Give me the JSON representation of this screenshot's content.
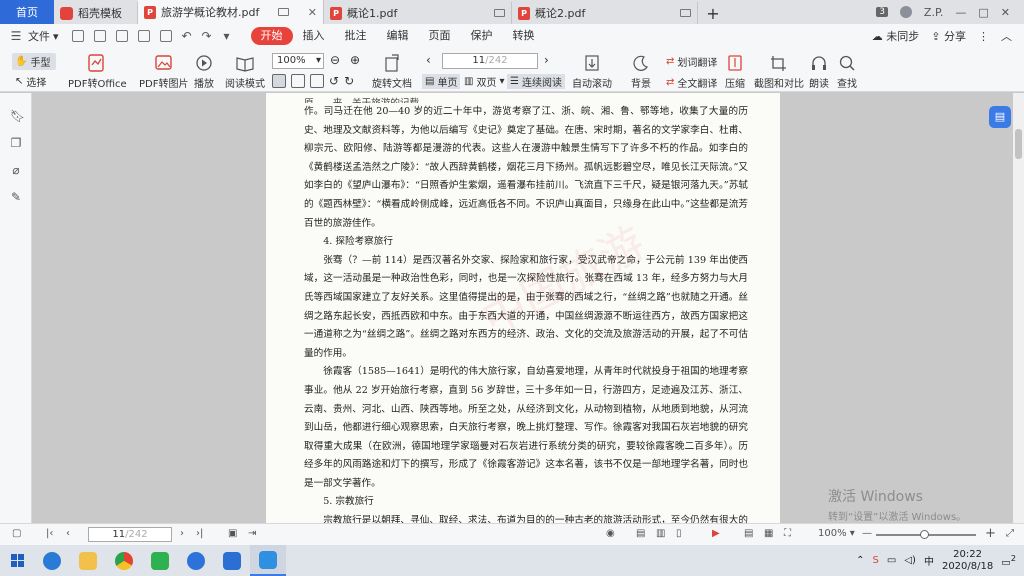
{
  "tabs": {
    "home": "首页",
    "items": [
      {
        "label": "稻壳模板"
      },
      {
        "label": "旅游学概论教材.pdf"
      },
      {
        "label": "概论1.pdf"
      },
      {
        "label": "概论2.pdf"
      }
    ],
    "add": "+"
  },
  "window": {
    "badge": "3",
    "user": "Z.P.",
    "minimize": "—",
    "restore": "□",
    "close": "✕"
  },
  "menu": {
    "file": "文件",
    "tabs": [
      "开始",
      "插入",
      "批注",
      "编辑",
      "页面",
      "保护",
      "转换"
    ],
    "sync": "未同步",
    "share": "分享"
  },
  "ribbon": {
    "hand": "手型",
    "select": "选择",
    "pdf_office": "PDF转Office",
    "pdf_image": "PDF转图片",
    "play": "播放",
    "read_mode": "阅读模式",
    "zoom": "100%",
    "rotate": "旋转文档",
    "page_current": "11",
    "page_total": "/242",
    "single": "单页",
    "double": "双页",
    "continuous": "连续阅读",
    "auto_scroll": "自动滚动",
    "background": "背景",
    "word_translate": "划词翻译",
    "full_translate": "全文翻译",
    "compress": "压缩",
    "screenshot": "截图和对比",
    "read_aloud": "朗读",
    "find": "查找"
  },
  "document": {
    "paragraphs": [
      {
        "type": "body",
        "text": "作。司马迁在他 20—40 岁的近二十年中，游览考察了江、浙、皖、湘、鲁、鄂等地，收集了大量的历史、地理及文献资料等，为他以后编写《史记》奠定了基础。在唐、宋时期，著名的文学家李白、杜甫、柳宗元、欧阳修、陆游等都是漫游的代表。这些人在漫游中触景生情写下了许多不朽的作品。如李白的《黄鹤楼送孟浩然之广陵》：“故人西辞黄鹤楼，烟花三月下扬州。孤帆远影碧空尽，唯见长江天际流。”又如李白的《望庐山瀑布》：“日照香炉生紫烟，遥看瀑布挂前川。飞流直下三千尺，疑是银河落九天。”苏轼的《题西林壁》：“横看成岭侧成峰，远近高低各不同。不识庐山真面目，只缘身在此山中。”这些都是流芳百世的旅游佳作。"
      },
      {
        "type": "heading",
        "text": "4. 探险考察旅行"
      },
      {
        "type": "indent",
        "text": "张骞（？—前 114）是西汉著名外交家、探险家和旅行家，受汉武帝之命，于公元前 139 年出使西域，这一活动虽是一种政治性色彩，同时，也是一次探险性旅行。张骞在西域 13 年，经多方努力与大月氏等西域国家建立了友好关系。这里值得提出的是，由于张骞的西域之行，“丝绸之路”也就随之开通。丝绸之路东起长安，西抵西欧和中东。由于东西大道的开通，中国丝绸源源不断运往西方，故西方国家把这一通道称之为“丝绸之路”。丝绸之路对东西方的经济、政治、文化的交流及旅游活动的开展，起了不可估量的作用。"
      },
      {
        "type": "indent",
        "text": "徐霞客（1585—1641）是明代的伟大旅行家，自幼喜爱地理，从青年时代就投身于祖国的地理考察事业。他从 22 岁开始旅行考察，直到 56 岁辞世，三十多年如一日，行游四方，足迹遍及江苏、浙江、云南、贵州、河北、山西、陕西等地。所至之处，从经济到文化，从动物到植物，从地质到地貌，从河流到山岳，他都进行细心观察思索，白天旅行考察，晚上挑灯整理、写作。徐霞客对我国石灰岩地貌的研究取得重大成果（在欧洲，德国地理学家瑙曼对石灰岩进行系统分类的研究，要较徐霞客晚二百多年）。历经多年的风雨路途和灯下的撰写，形成了《徐霞客游记》这本名著，该书不仅是一部地理学名著，同时也是一部文学著作。"
      },
      {
        "type": "heading",
        "text": "5. 宗教旅行"
      },
      {
        "type": "indent",
        "text": "宗教旅行是以朝拜、寻仙、取经、求法、布道为目的的一种古老的旅游活动形式，至今仍然有很大的吸引力。但古代中国的国际性宗教旅游，主要是佛教徒以朝拜、学佛、传法为目的的旅行活动。从魏晋盛行到唐代形成高潮，并出现了法显、玄奘、鉴真等著名宗教旅"
      }
    ],
    "watermark": "中国旅游"
  },
  "overlay": {
    "activate_title": "激活 Windows",
    "activate_sub": "转到“设置”以激活 Windows。"
  },
  "statusbar": {
    "page_current": "11",
    "page_total": "/242",
    "zoom": "100%",
    "minus": "—",
    "plus": "+"
  },
  "taskbar": {
    "lang": "中",
    "time": "20:22",
    "date": "2020/8/18",
    "notify": "2"
  }
}
